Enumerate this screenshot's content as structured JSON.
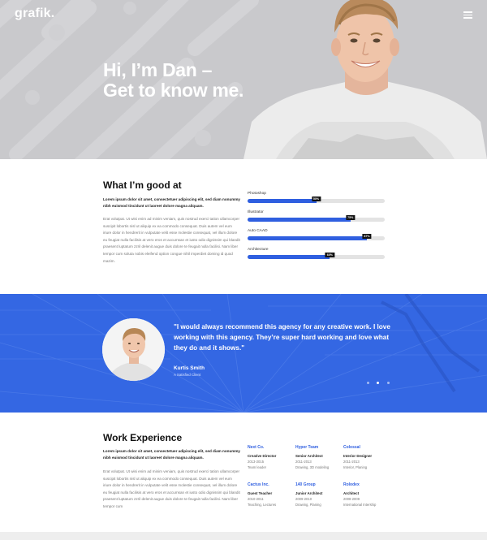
{
  "brand": {
    "logo": "grafik."
  },
  "hero": {
    "title_line1": "Hi, I’m Dan –",
    "title_line2": "Get to know me."
  },
  "skills": {
    "title": "What I’m good at",
    "lead": "Lorem ipsum dolor sit amet, consectetuer adipiscing elit, sed diam nonummy nibh euismod tincidunt ut laoreet dolore magna aliquam.",
    "body": "Erat volutpat. Ut wisi enim ad minim veniam, quis nostrud exerci tation ullamcorper suscipit lobortis nisl ut aliquip ex ea commodo consequat. Duis autem vel eum iriure dolor in hendrerit in vulputate velit esse molestie consequat, vel illum dolore eu feugiat nulla facilisis at vero eros et accumsan et iusto odio dignissim qui blandit praesent luptatum zzril delenit augue duis dolore te feugait nulla facilisi. Nam liber tempor cum soluta nobis eleifend option congue nihil imperdiet doming id quod mazim.",
    "items": [
      {
        "name": "Photoshop",
        "value": 50,
        "label": "50%"
      },
      {
        "name": "Illustrator",
        "value": 75,
        "label": "75%"
      },
      {
        "name": "Auto CAAD",
        "value": 87,
        "label": "87%"
      },
      {
        "name": "Architecture",
        "value": 60,
        "label": "60%"
      }
    ],
    "bar_color": "#2f5fe0"
  },
  "testimonial": {
    "quote": "\"I would always recommend this agency for any creative work. I love working with this agency. They’re super hard working and love what they do and it shows.\"",
    "name": "Kurtis Smith",
    "role": "A Satisfied Client",
    "dots": 3,
    "active_dot": 2,
    "bg_color": "#3467e3"
  },
  "work": {
    "title": "Work Experience",
    "lead": "Lorem ipsum dolor sit amet, consectetuer adipiscing elit, sed diam nonummy nibh euismod tincidunt ut laoreet dolore magna aliquam.",
    "body": "Erat volutpat. Ut wisi enim ad minim veniam, quis nostrud exerci tation ullamcorper suscipit lobortis nisl ut aliquip ex ea commodo consequat. Duis autem vel eum iriure dolor in hendrerit in vulputate velit esse molestie consequat, vel illum dolore eu feugiat nulla facilisis at vero eros et accumsan et iusto odio dignissim qui blandit praesent luptatum zzril delenit augue duis dolore te feugait nulla facilisi. Nam liber tempor cum",
    "jobs": [
      {
        "company": "Next Co.",
        "role": "Creative Director",
        "dates": "2013-2015",
        "note": "Team leader"
      },
      {
        "company": "Hyper Team",
        "role": "Senior Architect",
        "dates": "2011-2013",
        "note": "Drawing, 3D modeling"
      },
      {
        "company": "Colossal",
        "role": "Interior Designer",
        "dates": "2011-2013",
        "note": "Interior, Planing"
      },
      {
        "company": "Cactus Inc.",
        "role": "Guest Teacher",
        "dates": "2010-2011",
        "note": "Teaching, Lectures"
      },
      {
        "company": "140 Group",
        "role": "Junior Architect",
        "dates": "2009-2010",
        "note": "Drawing, Planing"
      },
      {
        "company": "Rolodex",
        "role": "Architect",
        "dates": "2008-2009",
        "note": "International Intership"
      }
    ]
  }
}
